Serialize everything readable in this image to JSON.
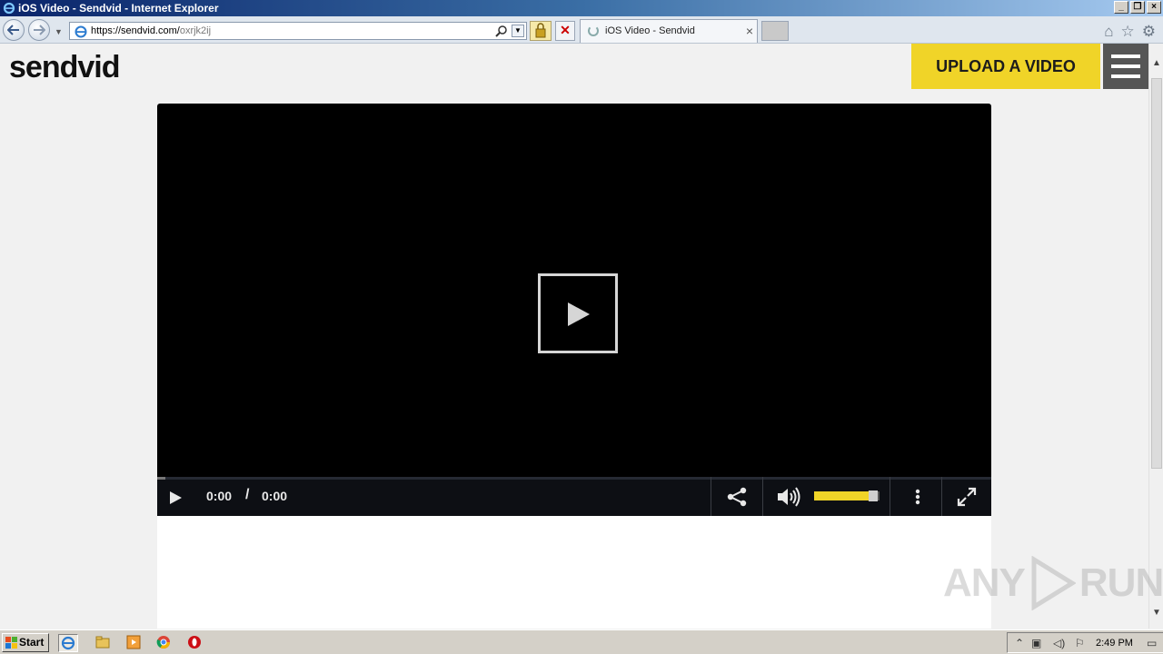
{
  "window": {
    "title": "iOS Video - Sendvid - Internet Explorer"
  },
  "browser": {
    "url_host": "https://sendvid.com/",
    "url_path": "oxrjk2ij",
    "tab_title": "iOS Video - Sendvid",
    "tab_close": "×",
    "stop_label": "✕"
  },
  "page": {
    "logo": "sendvid",
    "upload_label": "UPLOAD A VIDEO"
  },
  "player": {
    "current_time": "0:00",
    "separator": "/",
    "duration": "0:00",
    "progress": 0.01,
    "volume": 0.9
  },
  "watermark": {
    "left": "ANY",
    "right": "RUN"
  },
  "taskbar": {
    "start_label": "Start",
    "clock": "2:49 PM"
  },
  "colors": {
    "accent": "#f0d428",
    "player_bg": "#000000",
    "controls_bg": "#0d0f14"
  }
}
